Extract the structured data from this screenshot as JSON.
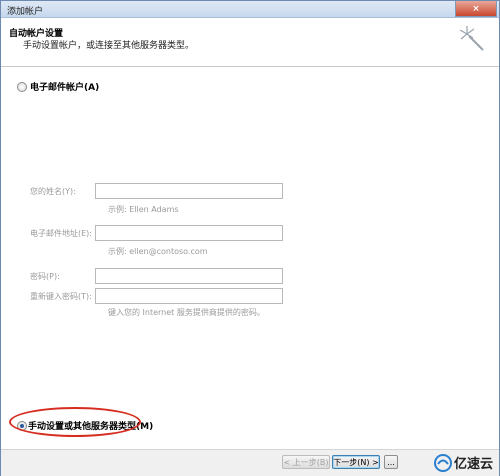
{
  "window": {
    "title": "添加帐户",
    "close_glyph": "×"
  },
  "header": {
    "title": "自动帐户设置",
    "subtitle": "手动设置帐户，或连接至其他服务器类型。"
  },
  "options": {
    "email_account": "电子邮件帐户(A)",
    "manual_setup": "手动设置或其他服务器类型(M)"
  },
  "form": {
    "name_label": "您的姓名(Y):",
    "name_hint": "示例: Ellen Adams",
    "email_label": "电子邮件地址(E):",
    "email_hint": "示例: ellen@contoso.com",
    "password_label": "密码(P):",
    "retype_label": "重新键入密码(T):",
    "password_hint": "键入您的 Internet 服务提供商提供的密码。"
  },
  "footer": {
    "back_button": "< 上一步(B)",
    "next_button": "下一步(N) >",
    "cancel_partial": "..."
  },
  "watermark": {
    "text": "亿速云"
  },
  "colors": {
    "highlight": "#d62d20",
    "accent": "#2a5b9a"
  }
}
